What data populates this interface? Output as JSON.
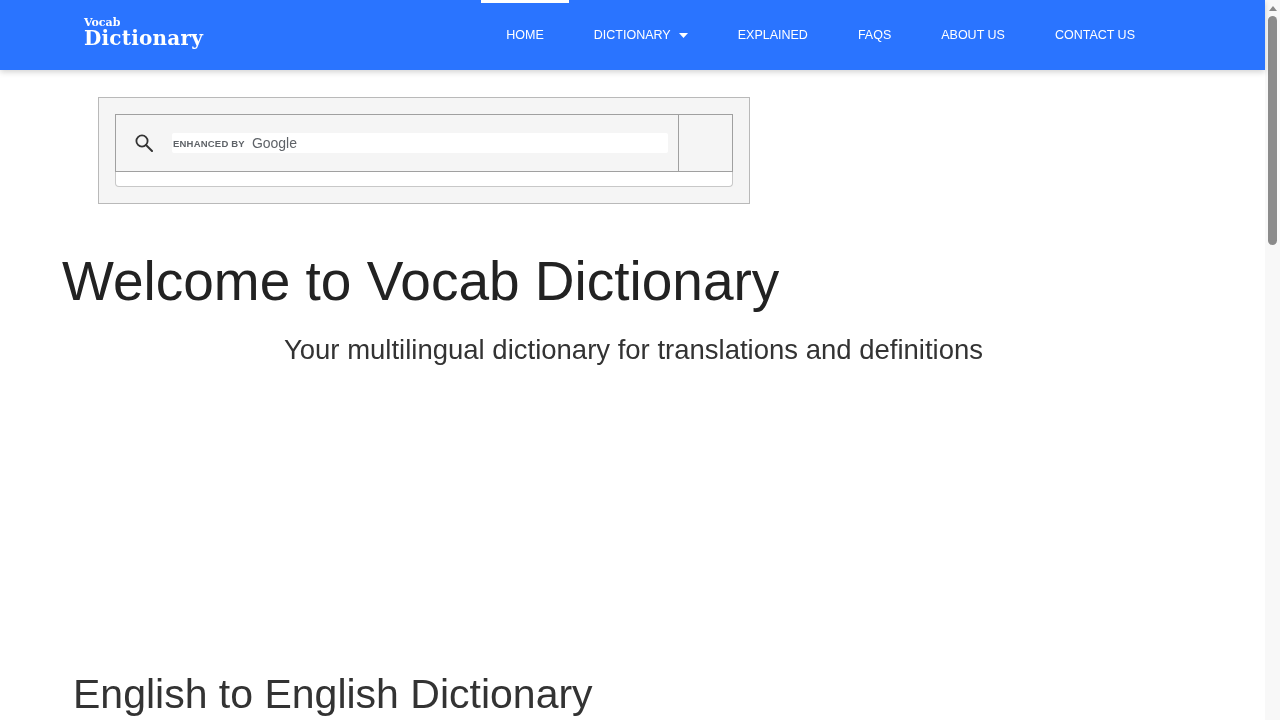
{
  "header": {
    "logo": {
      "line_1": "Vocab",
      "line_2": "Dictionary"
    },
    "nav": [
      {
        "label": "HOME",
        "selected": true,
        "dropdown": false
      },
      {
        "label": "DICTIONARY",
        "selected": false,
        "dropdown": true
      },
      {
        "label": "EXPLAINED",
        "selected": false,
        "dropdown": false
      },
      {
        "label": "FAQS",
        "selected": false,
        "dropdown": false
      },
      {
        "label": "ABOUT US",
        "selected": false,
        "dropdown": false
      },
      {
        "label": "CONTACT US",
        "selected": false,
        "dropdown": false
      }
    ]
  },
  "search": {
    "branding_label": "ENHANCED BY",
    "branding_brand": "Google"
  },
  "title": "Welcome to Vocab Dictionary",
  "subtitle": "Your multilingual dictionary for translations and definitions",
  "section_heading": "English to English Dictionary"
}
